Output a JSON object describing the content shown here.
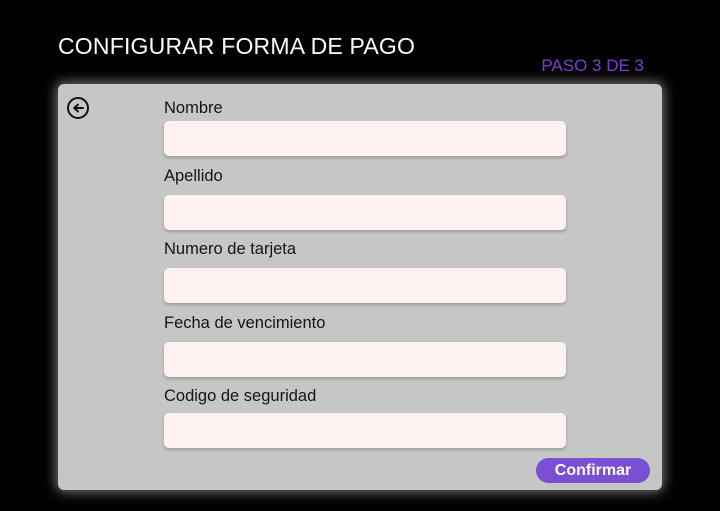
{
  "header": {
    "title": "CONFIGURAR FORMA DE PAGO",
    "step": "PASO 3 DE 3"
  },
  "form": {
    "back_icon": "arrow-left-circle-icon",
    "fields": [
      {
        "label": "Nombre",
        "value": "",
        "placeholder": ""
      },
      {
        "label": "Apellido",
        "value": "",
        "placeholder": ""
      },
      {
        "label": "Numero de tarjeta",
        "value": "",
        "placeholder": ""
      },
      {
        "label": "Fecha de vencimiento",
        "value": "",
        "placeholder": ""
      },
      {
        "label": "Codigo de seguridad",
        "value": "",
        "placeholder": ""
      }
    ],
    "confirm_label": "Confirmar"
  },
  "colors": {
    "background": "#000000",
    "panel": "#c6c6c6",
    "input": "#fdf2f0",
    "accent": "#7b4fd3",
    "step_text": "#7a3fd0"
  }
}
